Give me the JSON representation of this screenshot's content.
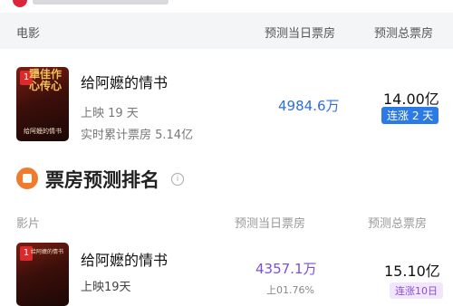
{
  "header": {
    "col_movie": "电影",
    "col_pred_today": "预测当日票房",
    "col_pred_total": "预测总票房"
  },
  "featured": {
    "rank": "1",
    "poster_text_top": "犟佳作心传心",
    "poster_text_sub": "给阿嬷的情书",
    "title": "给阿嬷的情书",
    "days": "上映 19 天",
    "cumulative": "实时累计票房 5.14亿",
    "pred_today": "4984.6万",
    "pred_total": "14.00亿",
    "badge": "连涨 2 天"
  },
  "section": {
    "title": "票房预测排名",
    "info_icon": "info-icon"
  },
  "list_header": {
    "col_movie": "影片",
    "col_pred_today": "预测当日票房",
    "col_pred_total": "预测总票房"
  },
  "list": [
    {
      "rank": "1",
      "poster_text": "给阿嬷的情书",
      "title": "给阿嬷的情书",
      "days": "上映19天",
      "change": "上01.76%",
      "pred_today": "4357.1万",
      "pred_total": "15.10亿",
      "badge": "连涨10日"
    }
  ],
  "colors": {
    "accent_blue": "#2c7be5",
    "accent_purple": "#7b4fd6",
    "section_icon": "#f07b2c",
    "rank_red": "#d92b2b"
  }
}
